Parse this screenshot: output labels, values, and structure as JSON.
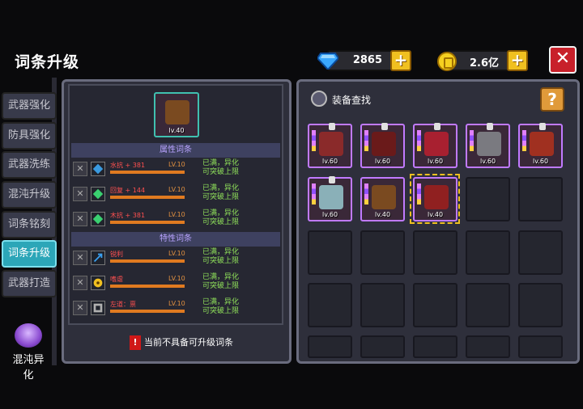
{
  "title": "词条升级",
  "diamonds": "2865",
  "gold": "2.6亿",
  "close": "✕",
  "sidebar": [
    "武器强化",
    "防具强化",
    "武器洗练",
    "混沌升级",
    "词条铭刻",
    "词条升级",
    "武器打造"
  ],
  "chaos_label": "混沌异化",
  "selected": {
    "lv": "lv.40"
  },
  "attr_header": "属性词条",
  "trait_header": "特性词条",
  "attrs": [
    {
      "name": "水抗 + 381",
      "lv": "LV.10",
      "status1": "已满，异化",
      "status2": "可突破上限",
      "color": "#3a9ae0"
    },
    {
      "name": "回复 + 144",
      "lv": "LV.10",
      "status1": "已满，异化",
      "status2": "可突破上限",
      "color": "#3ad070"
    },
    {
      "name": "木抗 + 381",
      "lv": "LV.10",
      "status1": "已满，异化",
      "status2": "可突破上限",
      "color": "#3ad070"
    }
  ],
  "traits": [
    {
      "name": "锐利",
      "lv": "LV.10",
      "status1": "已满，异化",
      "status2": "可突破上限",
      "color": "#3aa0f0"
    },
    {
      "name": "嗜虐",
      "lv": "LV.10",
      "status1": "已满，异化",
      "status2": "可突破上限",
      "color": "#f0c020"
    },
    {
      "name": "左道：禀",
      "lv": "LV.10",
      "status1": "已满，异化",
      "status2": "可突破上限",
      "color": "#b0b0b0"
    }
  ],
  "warning": "当前不具备可升级词条",
  "search_label": "装备查找",
  "help": "?",
  "equipment": [
    {
      "lv": "lv.60",
      "art": "#8a2a2a"
    },
    {
      "lv": "lv.60",
      "art": "#6a1a1a"
    },
    {
      "lv": "lv.60",
      "art": "#a82030"
    },
    {
      "lv": "lv.60",
      "art": "#7a7a80"
    },
    {
      "lv": "lv.60",
      "art": "#a03020"
    },
    {
      "lv": "lv.60",
      "art": "#8ab0b8"
    },
    {
      "lv": "lv.40",
      "art": "#7a4a20"
    },
    {
      "lv": "lv.40",
      "art": "#902020"
    }
  ]
}
